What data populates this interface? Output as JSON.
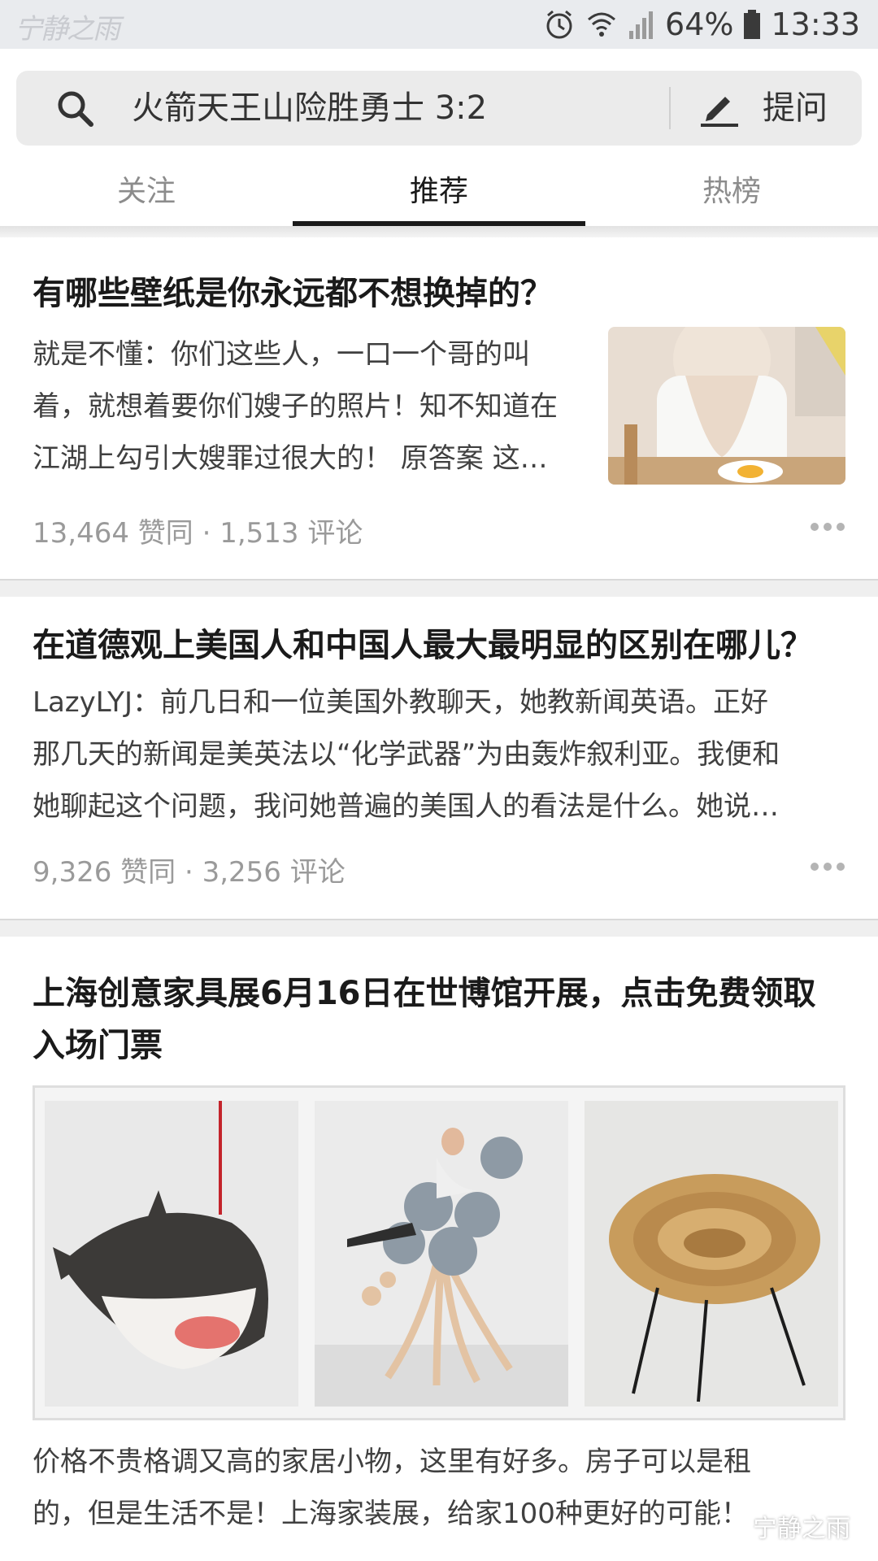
{
  "status_bar": {
    "watermark": "宁静之雨",
    "battery": "64%",
    "time": "13:33"
  },
  "search": {
    "query": "火箭天王山险胜勇士 3:2",
    "ask_label": "提问"
  },
  "tabs": [
    {
      "label": "关注",
      "active": false
    },
    {
      "label": "推荐",
      "active": true
    },
    {
      "label": "热榜",
      "active": false
    }
  ],
  "feed": [
    {
      "title": "有哪些壁纸是你永远都不想换掉的？",
      "excerpt_lines": [
        "就是不懂：你们这些人，一口一个哥的叫",
        "着，就想着要你们嫂子的照片！知不知道在",
        "江湖上勾引大嫂罪过很大的！ 原答案 这…"
      ],
      "meta": "13,464 赞同 · 1,513 评论"
    },
    {
      "title": "在道德观上美国人和中国人最大最明显的区别在哪儿？",
      "excerpt_lines": [
        "LazyLYJ：前几日和一位美国外教聊天，她教新闻英语。正好",
        "那几天的新闻是美英法以“化学武器”为由轰炸叙利亚。我便和",
        "她聊起这个问题，我问她普遍的美国人的看法是什么。她说…"
      ],
      "meta": "9,326 赞同 · 3,256 评论"
    },
    {
      "title_lines": [
        "上海创意家具展6月16日在世博馆开展，点击免费领取",
        "入场门票"
      ],
      "excerpt_lines": [
        "价格不贵格调又高的家居小物，这里有好多。房子可以是租",
        "的，但是生活不是！上海家装展，给家100种更好的可能！"
      ]
    }
  ],
  "watermark": "宁静之雨",
  "colors": {
    "status_bar_bg": "#e9ebee",
    "search_bg": "#ebebeb",
    "text_primary": "#1a1a1a",
    "text_secondary": "#9a9a9a"
  }
}
